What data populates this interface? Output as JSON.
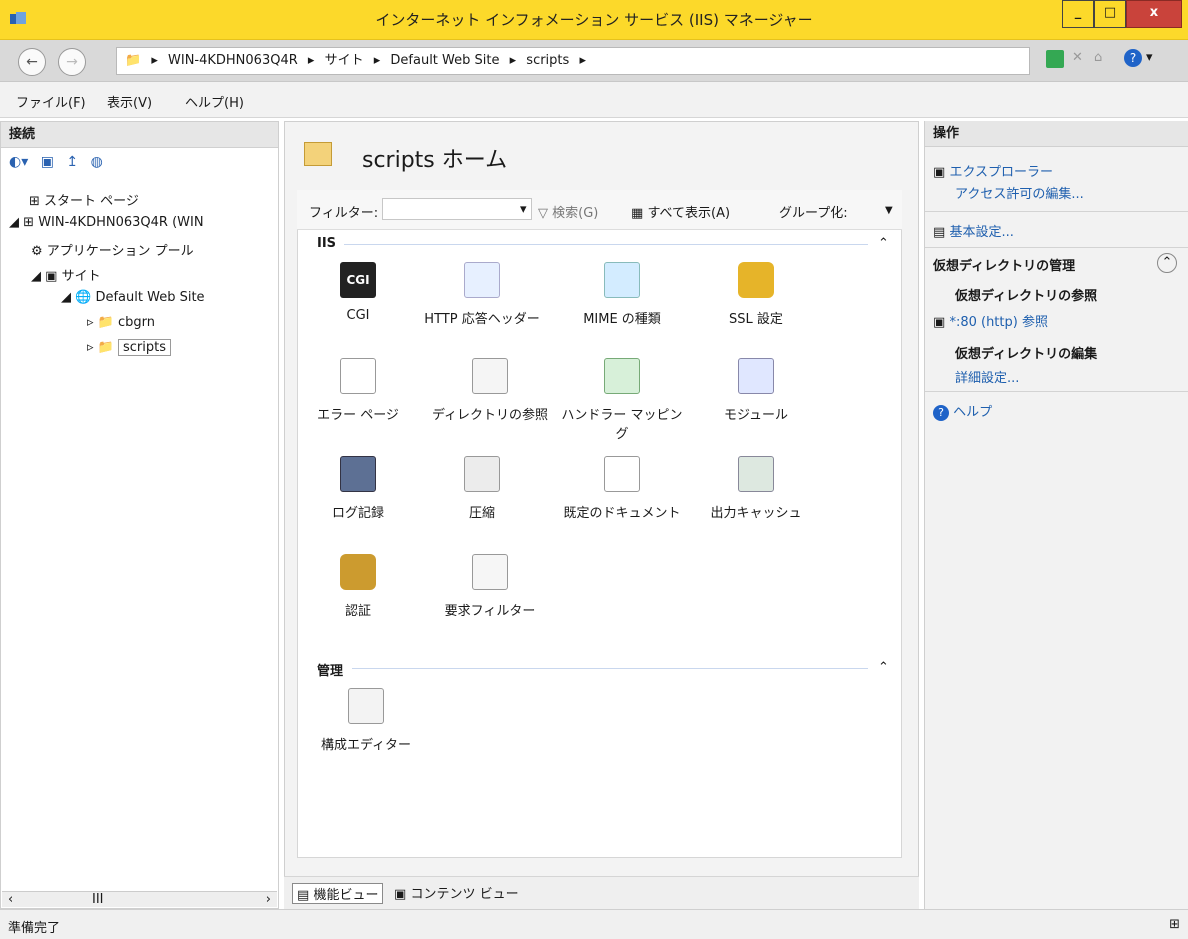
{
  "window": {
    "title": "インターネット インフォメーション サービス (IIS) マネージャー",
    "controls": [
      "minimize",
      "maximize",
      "close"
    ]
  },
  "nav": {
    "breadcrumb": [
      "WIN-4KDHN063Q4R",
      "サイト",
      "Default Web Site",
      "scripts"
    ]
  },
  "menu": {
    "file": "ファイル(F)",
    "view": "表示(V)",
    "help": "ヘルプ(H)"
  },
  "connections": {
    "title": "接続",
    "tree": [
      {
        "label": "スタート ページ",
        "level": 1
      },
      {
        "label": "WIN-4KDHN063Q4R (WIN",
        "level": 1
      },
      {
        "label": "アプリケーション プール",
        "level": 2
      },
      {
        "label": "サイト",
        "level": 2
      },
      {
        "label": "Default Web Site",
        "level": 3
      },
      {
        "label": "cbgrn",
        "level": 4
      },
      {
        "label": "scripts",
        "level": 4
      }
    ]
  },
  "center": {
    "page_title": "scripts ホーム",
    "filter_label": "フィルター:",
    "search_label": "検索(G)",
    "show_all_label": "すべて表示(A)",
    "group_label": "グループ化:",
    "sections": {
      "iis": "IIS",
      "management": "管理"
    },
    "features": {
      "cgi": "CGI",
      "http": "HTTP 応答ヘッダー",
      "mime": "MIME の種類",
      "ssl": "SSL 設定",
      "error": "エラー ページ",
      "dir": "ディレクトリの参照",
      "handler": "ハンドラー マッピング",
      "module": "モジュール",
      "log": "ログ記録",
      "compress": "圧縮",
      "default_doc": "既定のドキュメント",
      "cache": "出力キャッシュ",
      "auth": "認証",
      "request_filter": "要求フィルター",
      "config_editor": "構成エディター"
    },
    "tabs": {
      "feature_view": "機能ビュー",
      "content_view": "コンテンツ ビュー"
    }
  },
  "actions": {
    "title": "操作",
    "explore": "エクスプローラー",
    "edit_permissions": "アクセス許可の編集...",
    "basic_settings": "基本設定...",
    "vdir_manage": "仮想ディレクトリの管理",
    "vdir_browse": "仮想ディレクトリの参照",
    "browse_80": "*:80 (http) 参照",
    "vdir_edit": "仮想ディレクトリの編集",
    "advanced_settings": "詳細設定...",
    "help": "ヘルプ"
  },
  "status": {
    "text": "準備完了"
  },
  "colors": {
    "titlebar": "#fcd92a",
    "link": "#1e5fae"
  }
}
